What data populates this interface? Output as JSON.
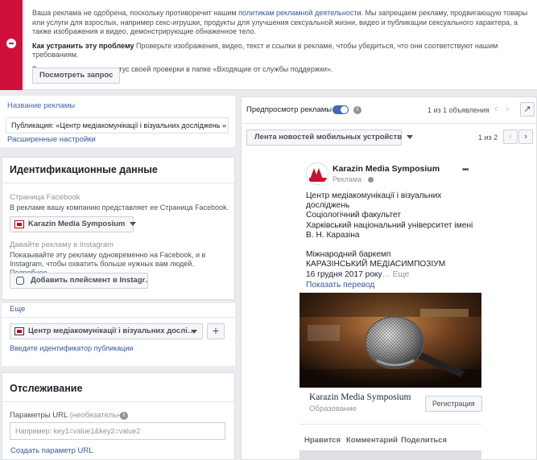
{
  "alert": {
    "text1": "Ваша реклама не одобрена, поскольку противоречит нашим ",
    "policy_link": "политикам рекламной деятельности",
    "text2": ". Мы запрещаем рекламу, продвигающую товары или услуги для взрослых, например секс-игрушки, продукты для улучшения сексуальной жизни, видео и публикации сексуального характера, а также изображения и видео, демонстрирующие обнаженное тело.",
    "fix_title": "Как устранить эту проблему",
    "fix_text": " Проверьте изображения, видео, текст и ссылки в рекламе, чтобы убедиться, что они соответствуют нашим требованиям.",
    "status_text": "Вы можете проверить статус своей проверки в папке «Входящие от службы поддержки».",
    "button": "Посмотреть запрос"
  },
  "ad_name": {
    "label": "Название рекламы",
    "value": "Публикация: «Центр медіакомунікації і візуальних досліджень »",
    "advanced_link": "Расширенные настройки"
  },
  "identity": {
    "title": "Идентификационные данные",
    "fb_page_label": "Страница Facebook",
    "fb_page_desc": "В рекламе вашу компанию представляет ее Страница Facebook.",
    "fb_page_value": "Karazin Media Symposium",
    "ig_label": "Давайте рекламу в Instagram",
    "ig_desc": "Показывайте эту рекламу одновременно на Facebook, и в Instagram, чтобы охватить больше нужных вам людей. ",
    "ig_more_link": "Подробнее.",
    "ig_button": "Добавить плейсмент в Instagr…"
  },
  "post_select": {
    "more_link": "Еще",
    "value": "Центр медіакомунікації і візуальних дослі…",
    "add_icon": "+",
    "post_id_link": "Введите идентификатор публикации"
  },
  "tracking": {
    "title": "Отслеживание",
    "url_label": "Параметры URL",
    "optional": "(необязательно)",
    "url_placeholder": "Например: key1=value1&key2=value2",
    "build_link": "Создать параметр URL"
  },
  "preview": {
    "label": "Предпросмотр рекламы",
    "count": "1 из 1 объявления",
    "placement": "Лента новостей мобильных устройств",
    "page_count": "1 из 2",
    "prev": "‹",
    "next": "›",
    "external_icon": "↗"
  },
  "post": {
    "page_name": "Karazin Media Symposium",
    "sponsored": "Реклама · ",
    "more_icon": "•••",
    "text": "Центр медіакомунікації і візуальних досліджень\nСоціологічний факультет\nХарківський національний університет імені В. Н. Каразіна\n\nМіжнародний баркемп\nКАРАЗІНСЬКИЙ МЕДІАСИМПОЗІУМ\n16 грудня 2017 року",
    "see_more": "… Еще",
    "translation": "Показать перевод",
    "footer_title": "Karazin Media Symposium",
    "footer_sub": "Образование",
    "cta": "Регистрация",
    "actions": [
      "Нравится",
      "Комментарий",
      "Поделиться"
    ],
    "logo_text": "KARAZIN MEDIA SYMPOSIUM"
  },
  "colors": {
    "alert_red": "#d0103a",
    "link_blue": "#365899",
    "toggle_blue": "#4267b2"
  }
}
